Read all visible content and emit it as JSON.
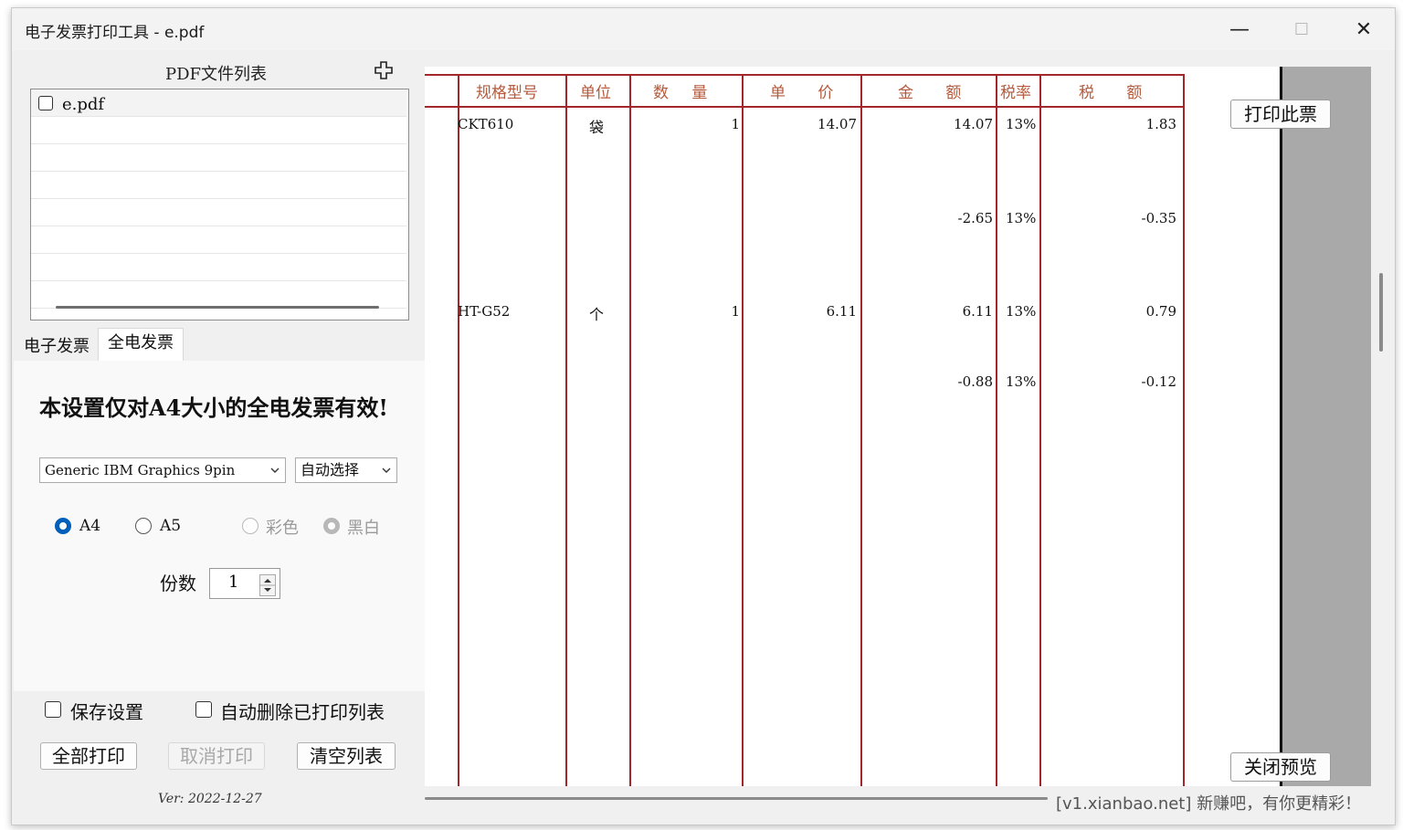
{
  "window": {
    "title": "电子发票打印工具 - e.pdf",
    "minimize_glyph": "—",
    "maximize_glyph": "☐",
    "close_glyph": "✕"
  },
  "file_list": {
    "header": "PDF文件列表",
    "add_icon": "add-icon",
    "items": [
      {
        "name": "e.pdf",
        "checked": false
      }
    ]
  },
  "tabs": [
    {
      "label": "电子发票",
      "active": false
    },
    {
      "label": "全电发票",
      "active": true
    }
  ],
  "settings": {
    "notice": "本设置仅对A4大小的全电发票有效!",
    "printer": "Generic IBM Graphics 9pin",
    "mode": "自动选择",
    "paper_a4": "A4",
    "paper_a5": "A5",
    "color": "彩色",
    "bw": "黑白",
    "copies_label": "份数",
    "copies": "1"
  },
  "bottom": {
    "save_settings": "保存设置",
    "auto_delete": "自动删除已打印列表",
    "print_all": "全部打印",
    "cancel_print": "取消打印",
    "clear_list": "清空列表",
    "version": "Ver: 2022-12-27"
  },
  "invoice": {
    "headers": [
      "规格型号",
      "单位",
      "数 量",
      "单 价",
      "金 额",
      "税率",
      "税 额"
    ],
    "rows": [
      {
        "spec": "CKT610",
        "unit": "袋",
        "qty": "1",
        "price": "14.07",
        "amount": "14.07",
        "rate": "13%",
        "tax": "1.83"
      },
      {
        "spec": "",
        "unit": "",
        "qty": "",
        "price": "",
        "amount": "-2.65",
        "rate": "13%",
        "tax": "-0.35"
      },
      {
        "spec": "HT-G52",
        "unit": "个",
        "qty": "1",
        "price": "6.11",
        "amount": "6.11",
        "rate": "13%",
        "tax": "0.79"
      },
      {
        "spec": "",
        "unit": "",
        "qty": "",
        "price": "",
        "amount": "-0.88",
        "rate": "13%",
        "tax": "-0.12"
      }
    ],
    "colors": {
      "rule": "#a3262a",
      "header": "#b55a3c"
    }
  },
  "preview": {
    "print_this": "打印此票",
    "close_preview": "关闭预览"
  },
  "watermark": "[v1.xianbao.net] 新赚吧，有你更精彩！"
}
